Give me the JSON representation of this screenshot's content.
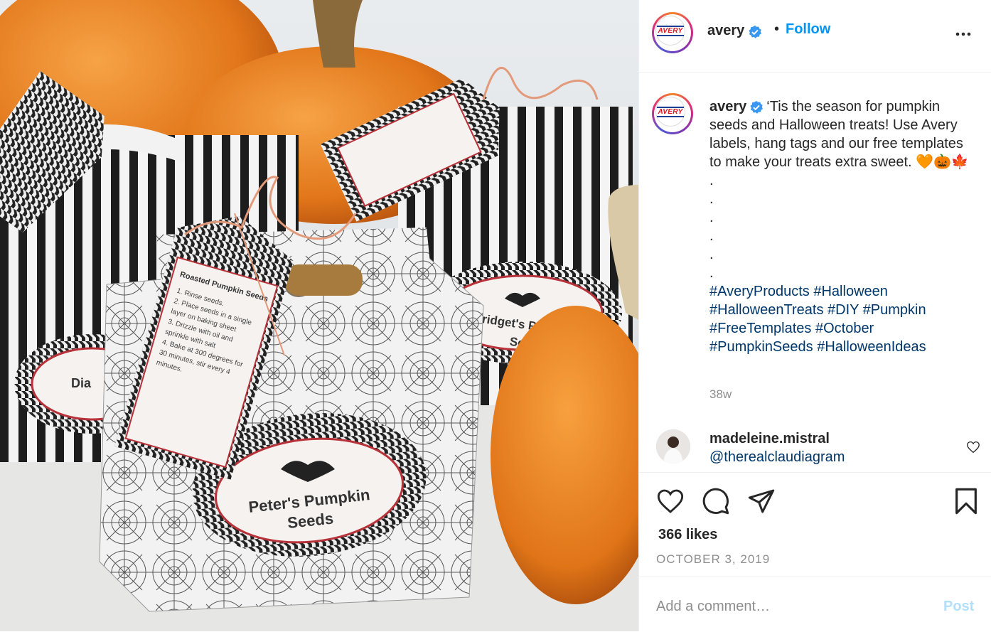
{
  "post": {
    "username": "avery",
    "follow_label": "Follow",
    "separator": "•",
    "avatar_text": "AVERY",
    "caption_text": "‘Tis the season for pumpkin seeds and Halloween treats! Use Avery labels, hang tags and our free templates to make your treats extra sweet. 🧡🎃🍁",
    "caption_dots": [
      ".",
      ".",
      ".",
      ".",
      ".",
      "."
    ],
    "hashtags": "#AveryProducts #Halloween #HalloweenTreats #DIY #Pumpkin #FreeTemplates #October #PumpkinSeeds #HalloweenIdeas",
    "age": "38w",
    "likes": "366 likes",
    "date": "OCTOBER 3, 2019"
  },
  "comment": {
    "username": "madeleine.mistral",
    "mention": "@therealclaudiagram"
  },
  "add_comment": {
    "placeholder": "Add a comment…",
    "post_label": "Post"
  },
  "photo": {
    "tag_title": "Roasted Pumpkin Seeds",
    "tag_steps": [
      "1. Rinse seeds.",
      "2. Place seeds in a single",
      "layer on baking sheet",
      "3. Drizzle with oil and",
      "sprinkle with salt",
      "4. Bake at 300 degrees for",
      "30 minutes, stir every 4",
      "minutes."
    ],
    "label_front_line1": "Peter's Pumpkin",
    "label_front_line2": "Seeds",
    "label_back_right": "Bridget's Pum",
    "label_back_right2": "See",
    "label_back_left": "Dia"
  },
  "colors": {
    "link": "#0095f6",
    "hashtag": "#00376b",
    "pumpkin": "#e8841f",
    "muted": "#8e8e8e"
  }
}
